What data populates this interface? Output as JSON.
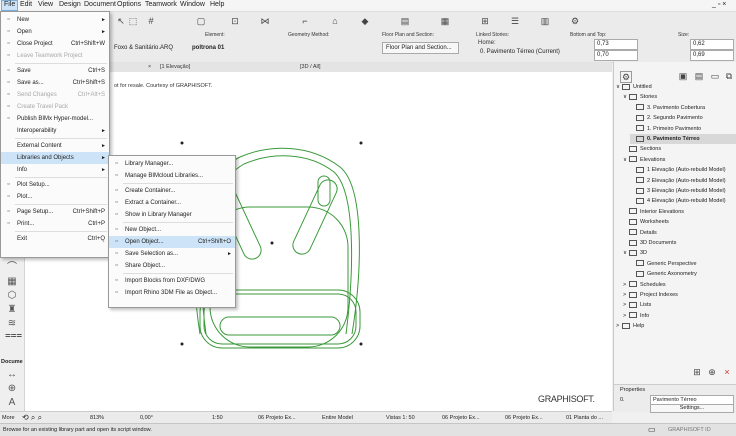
{
  "menubar": {
    "items": [
      "File",
      "Edit",
      "View",
      "Design",
      "Document",
      "Options",
      "Teamwork",
      "Window",
      "Help"
    ],
    "window_controls": "_ ▫ ×"
  },
  "toolbar": {
    "element_label": "Element:",
    "element_value": "poltrona 01",
    "library_value": "Foxo & Sanitário.ARQ",
    "geometry_label": "Geometry Method:",
    "floorplan_label": "Floor Plan and Section:",
    "floorplan_value": "Floor Plan and Section...",
    "linked_label": "Linked Stories:",
    "home_label": "Home:",
    "home_value": "0. Pavimento Térreo (Current)",
    "bottomtop_label": "Bottom and Top:",
    "bottom_value": "0,73",
    "top_value": "0,70",
    "size_label": "Size:",
    "size_a": "0,62",
    "size_b": "0,69"
  },
  "tabs": [
    {
      "label": "[1 Elevação]",
      "close": "×"
    },
    {
      "label": "[3D / All]"
    }
  ],
  "canvas": {
    "notice": "ot for resale. Courtesy of GRAPHISOFT.",
    "watermark": "GRAPHISOFT."
  },
  "file_menu": [
    {
      "label": "New",
      "icon": "new-file-icon",
      "arrow": "►"
    },
    {
      "label": "Open",
      "icon": "open-folder-icon",
      "arrow": "►"
    },
    {
      "label": "Close Project",
      "shortcut": "Ctrl+Shift+W",
      "icon": "close-project-icon"
    },
    {
      "label": "Leave Teamwork Project",
      "disabled": true,
      "icon": "leave-icon"
    },
    {
      "sep": true
    },
    {
      "label": "Save",
      "shortcut": "Ctrl+S",
      "icon": "save-icon"
    },
    {
      "label": "Save as...",
      "shortcut": "Ctrl+Shift+S",
      "icon": "save-as-icon"
    },
    {
      "label": "Send Changes",
      "shortcut": "Ctrl+Alt+S",
      "disabled": true,
      "icon": "send-changes-icon"
    },
    {
      "label": "Create Travel Pack",
      "disabled": true,
      "icon": "travel-pack-icon"
    },
    {
      "label": "Publish BIMx Hyper-model...",
      "icon": "bimx-icon"
    },
    {
      "label": "Interoperability",
      "arrow": "►"
    },
    {
      "sep": true
    },
    {
      "label": "External Content",
      "arrow": "►"
    },
    {
      "label": "Libraries and Objects",
      "arrow": "►",
      "highlight": true
    },
    {
      "label": "Info",
      "arrow": "►"
    },
    {
      "sep": true
    },
    {
      "label": "Plot Setup...",
      "icon": "plot-setup-icon"
    },
    {
      "label": "Plot...",
      "icon": "plot-icon"
    },
    {
      "sep": true
    },
    {
      "label": "Page Setup...",
      "shortcut": "Ctrl+Shift+P",
      "icon": "page-setup-icon"
    },
    {
      "label": "Print...",
      "shortcut": "Ctrl+P",
      "icon": "print-icon"
    },
    {
      "sep": true
    },
    {
      "label": "Exit",
      "shortcut": "Ctrl+Q"
    }
  ],
  "lib_menu": [
    {
      "label": "Library Manager...",
      "icon": "library-manager-icon"
    },
    {
      "label": "Manage BIMcloud Libraries...",
      "icon": "bimcloud-icon"
    },
    {
      "sep": true
    },
    {
      "label": "Create Container...",
      "icon": "create-container-icon"
    },
    {
      "label": "Extract a Container...",
      "icon": "extract-container-icon"
    },
    {
      "label": "Show in Library Manager",
      "icon": "show-library-icon"
    },
    {
      "sep": true
    },
    {
      "label": "New Object...",
      "icon": "new-object-icon"
    },
    {
      "label": "Open Object...",
      "shortcut": "Ctrl+Shift+O",
      "icon": "open-object-icon",
      "highlight": true
    },
    {
      "label": "Save Selection as...",
      "icon": "save-selection-icon",
      "arrow": "►"
    },
    {
      "label": "Share Object...",
      "icon": "share-object-icon"
    },
    {
      "sep": true
    },
    {
      "label": "Import Blocks from DXF/DWG",
      "icon": "import-dxf-icon"
    },
    {
      "label": "Import Rhino 3DM File as Object...",
      "icon": "import-rhino-icon"
    }
  ],
  "navigator": {
    "items": [
      {
        "label": "Untitled",
        "level": 0,
        "arrow": "∨"
      },
      {
        "label": "Stories",
        "level": 1,
        "arrow": "∨"
      },
      {
        "label": "3. Pavimento Cobertura",
        "level": 2
      },
      {
        "label": "2. Segundo Pavimento",
        "level": 2
      },
      {
        "label": "1. Primeiro Pavimento",
        "level": 2
      },
      {
        "label": "0. Pavimento Térreo",
        "level": 2,
        "selected": true
      },
      {
        "label": "Sections",
        "level": 1
      },
      {
        "label": "Elevations",
        "level": 1,
        "arrow": "∨"
      },
      {
        "label": "1 Elevação (Auto-rebuild Model)",
        "level": 2
      },
      {
        "label": "2 Elevação (Auto-rebuild Model)",
        "level": 2
      },
      {
        "label": "3 Elevação (Auto-rebuild Model)",
        "level": 2
      },
      {
        "label": "4 Elevação (Auto-rebuild Model)",
        "level": 2
      },
      {
        "label": "Interior Elevations",
        "level": 1
      },
      {
        "label": "Worksheets",
        "level": 1
      },
      {
        "label": "Details",
        "level": 1
      },
      {
        "label": "3D Documents",
        "level": 1
      },
      {
        "label": "3D",
        "level": 1,
        "arrow": "∨"
      },
      {
        "label": "Generic Perspective",
        "level": 2
      },
      {
        "label": "Generic Axonometry",
        "level": 2
      },
      {
        "label": "Schedules",
        "level": 1,
        "arrow": ">"
      },
      {
        "label": "Project Indexes",
        "level": 1,
        "arrow": ">"
      },
      {
        "label": "Lists",
        "level": 1,
        "arrow": ">"
      },
      {
        "label": "Info",
        "level": 1,
        "arrow": ">"
      },
      {
        "label": "Help",
        "level": 0,
        "arrow": ">"
      }
    ]
  },
  "properties": {
    "title": "Properties",
    "id_value": "0.",
    "name_value": "Pavimento Térreo",
    "settings_label": "Settings..."
  },
  "bottombar": {
    "more_label": "More",
    "zoom": "813%",
    "angle": "0,00°",
    "scale": "1:50",
    "view_a": "06 Projeto Ex...",
    "model": "Entire Model",
    "vistas": "Vistas 1: 50",
    "view_b": "06 Projeto Ex...",
    "view_c": "06 Projeto Ex...",
    "plan": "01 Planta do ..."
  },
  "status": {
    "text": "Browse for an existing library part and open its script window.",
    "brand": "GRAPHISOFT ID"
  },
  "toolbox_label": "Docume"
}
